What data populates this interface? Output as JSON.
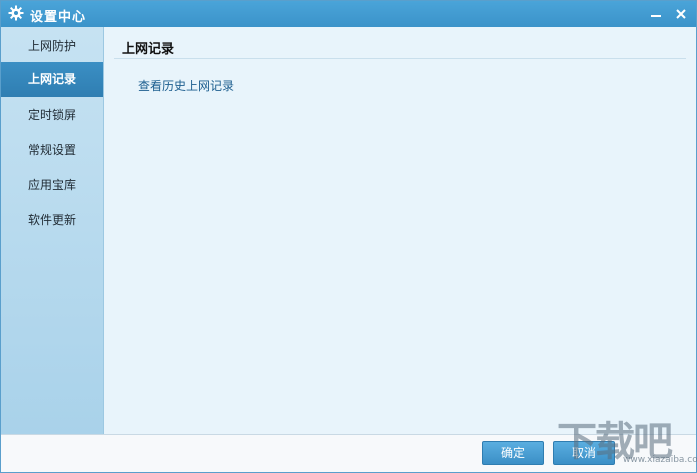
{
  "window": {
    "title": "设置中心",
    "icon": "gear-icon"
  },
  "sidebar": {
    "items": [
      {
        "label": "上网防护",
        "active": false
      },
      {
        "label": "上网记录",
        "active": true
      },
      {
        "label": "定时锁屏",
        "active": false
      },
      {
        "label": "常规设置",
        "active": false
      },
      {
        "label": "应用宝库",
        "active": false
      },
      {
        "label": "软件更新",
        "active": false
      }
    ]
  },
  "main": {
    "section_title": "上网记录",
    "history_link": "查看历史上网记录"
  },
  "footer": {
    "ok_label": "确定",
    "cancel_label": "取消"
  },
  "watermark": {
    "text": "下载吧",
    "url": "www.xiazaiba.com"
  },
  "colors": {
    "titlebar": "#3b93c9",
    "active_item": "#2f7eb2",
    "content_bg": "#e8f4fb",
    "link": "#1c5e8f"
  }
}
